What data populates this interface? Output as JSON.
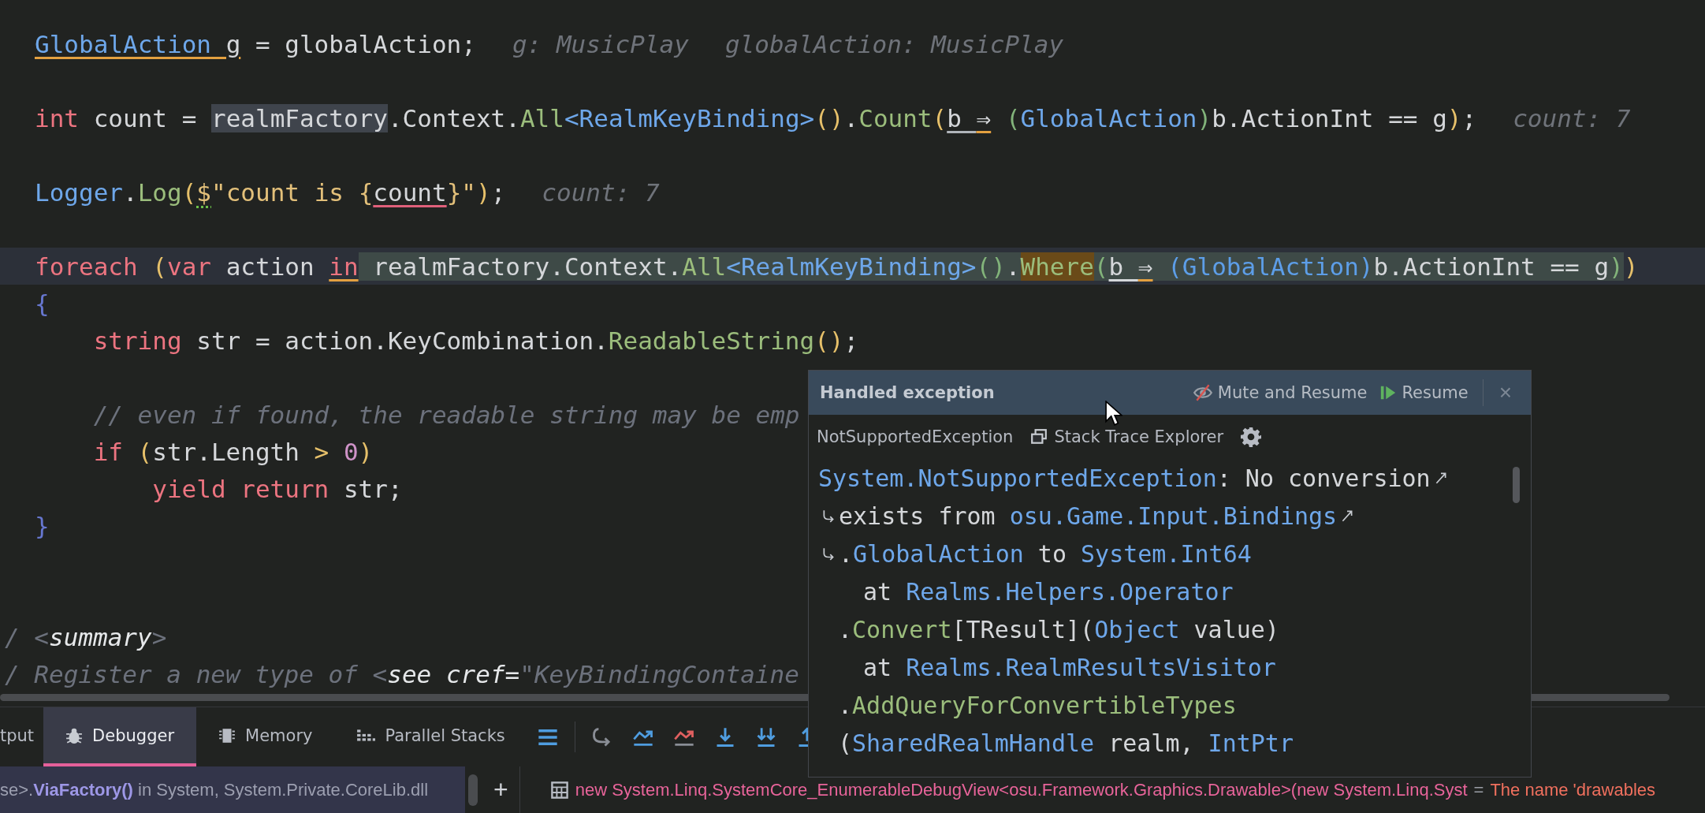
{
  "editor": {
    "lines": [
      {
        "kind": "code",
        "current": false,
        "segments": [
          {
            "text": "GlobalAction",
            "kind": "type",
            "underline": {
              "color": "#e3a040"
            }
          },
          {
            "text": " g",
            "kind": "plain",
            "underline": {
              "color": "#e3a040"
            }
          },
          {
            "text": " = globalAction;",
            "kind": "plain"
          }
        ],
        "hints": [
          "g: MusicPlay",
          "globalAction: MusicPlay"
        ]
      },
      {
        "kind": "blank"
      },
      {
        "kind": "code",
        "current": false,
        "segments": [
          {
            "text": "int",
            "kind": "keyword"
          },
          {
            "text": " count = ",
            "kind": "plain"
          },
          {
            "text": "realmFactory",
            "kind": "plain",
            "usage_highlight": true
          },
          {
            "text": ".Context.",
            "kind": "plain"
          },
          {
            "text": "All",
            "kind": "method"
          },
          {
            "text": "<RealmKeyBinding>",
            "kind": "type"
          },
          {
            "text": "()",
            "kind": "paren1"
          },
          {
            "text": ".",
            "kind": "plain"
          },
          {
            "text": "Count",
            "kind": "method"
          },
          {
            "text": "(",
            "kind": "paren1"
          },
          {
            "text": "b ",
            "kind": "plain",
            "underline": {
              "color": "#b0b4ba"
            }
          },
          {
            "text": "⇒",
            "kind": "plain",
            "underline": {
              "color": "#e3a040"
            }
          },
          {
            "text": " (",
            "kind": "paren2"
          },
          {
            "text": "GlobalAction",
            "kind": "type"
          },
          {
            "text": ")",
            "kind": "paren2"
          },
          {
            "text": "b.ActionInt == g",
            "kind": "plain"
          },
          {
            "text": ")",
            "kind": "paren1"
          },
          {
            "text": ";",
            "kind": "plain"
          }
        ],
        "hints": [
          "count: 7"
        ]
      },
      {
        "kind": "blank"
      },
      {
        "kind": "code",
        "current": false,
        "segments": [
          {
            "text": "Logger",
            "kind": "type"
          },
          {
            "text": ".",
            "kind": "plain"
          },
          {
            "text": "Log",
            "kind": "method"
          },
          {
            "text": "(",
            "kind": "paren1"
          },
          {
            "text": "$",
            "kind": "string",
            "underline": {
              "color": "#6cc04a",
              "dotted": true
            }
          },
          {
            "text": "\"count is {",
            "kind": "string"
          },
          {
            "text": "count",
            "kind": "plain",
            "underline": {
              "color": "#e0607a"
            }
          },
          {
            "text": "}\"",
            "kind": "string"
          },
          {
            "text": ")",
            "kind": "paren1"
          },
          {
            "text": ";",
            "kind": "plain"
          }
        ],
        "hints": [
          "count: 7"
        ]
      },
      {
        "kind": "blank"
      },
      {
        "kind": "code",
        "current": true,
        "segments": [
          {
            "text": "foreach",
            "kind": "keyword"
          },
          {
            "text": " (",
            "kind": "paren1"
          },
          {
            "text": "var",
            "kind": "keyword"
          },
          {
            "text": " action ",
            "kind": "plain"
          },
          {
            "text": "in",
            "kind": "keyword",
            "underline": {
              "color": "#e3a040"
            }
          },
          {
            "text": " realmFactory.Context.",
            "kind": "plain",
            "selection": true
          },
          {
            "text": "All",
            "kind": "method",
            "selection": true
          },
          {
            "text": "<RealmKeyBinding>",
            "kind": "type",
            "selection": true
          },
          {
            "text": "()",
            "kind": "paren2",
            "selection": true
          },
          {
            "text": ".",
            "kind": "plain",
            "selection": true
          },
          {
            "text": "Where",
            "kind": "method",
            "selection": true,
            "search_match": true
          },
          {
            "text": "(",
            "kind": "paren2",
            "selection": true
          },
          {
            "text": "b ",
            "kind": "plain",
            "selection": true,
            "underline": {
              "color": "#d5d7da"
            }
          },
          {
            "text": "⇒",
            "kind": "plain",
            "selection": true,
            "underline": {
              "color": "#e3a040"
            }
          },
          {
            "text": " (GlobalAction)",
            "kind": "paren3",
            "selection": true
          },
          {
            "text": "b.ActionInt == g",
            "kind": "plain",
            "selection": true
          },
          {
            "text": ")",
            "kind": "paren2",
            "selection": true
          },
          {
            "text": ")",
            "kind": "paren1"
          }
        ]
      },
      {
        "kind": "code",
        "current": false,
        "segments": [
          {
            "text": "{",
            "kind": "brace"
          }
        ],
        "children": [
          {
            "kind": "code",
            "current": false,
            "segments": [
              {
                "text": "string",
                "kind": "keyword"
              },
              {
                "text": " str = action.KeyCombination.",
                "kind": "plain"
              },
              {
                "text": "ReadableString",
                "kind": "method"
              },
              {
                "text": "()",
                "kind": "paren1"
              },
              {
                "text": ";",
                "kind": "plain"
              }
            ]
          },
          {
            "kind": "blank"
          },
          {
            "kind": "code",
            "current": false,
            "segments": [
              {
                "text": "// even if found, the readable string may be emp",
                "kind": "comment"
              }
            ]
          },
          {
            "kind": "code",
            "current": false,
            "segments": [
              {
                "text": "if",
                "kind": "keyword"
              },
              {
                "text": " (",
                "kind": "paren1"
              },
              {
                "text": "str.Length ",
                "kind": "plain"
              },
              {
                "text": "> ",
                "kind": "operator"
              },
              {
                "text": "0",
                "kind": "number"
              },
              {
                "text": ")",
                "kind": "paren1"
              }
            ],
            "children": [
              {
                "kind": "code",
                "current": false,
                "segments": [
                  {
                    "text": "yield return",
                    "kind": "keyword"
                  },
                  {
                    "text": " str;",
                    "kind": "plain"
                  }
                ]
              }
            ]
          }
        ]
      },
      {
        "kind": "code",
        "current": false,
        "segments": [
          {
            "text": "}",
            "kind": "brace"
          }
        ]
      },
      {
        "kind": "blank"
      },
      {
        "kind": "blank"
      },
      {
        "kind": "doc",
        "current": false,
        "segments": [
          {
            "text": "/ <",
            "kind": "comment"
          },
          {
            "text": "summary",
            "kind": "doc-tag"
          },
          {
            "text": ">",
            "kind": "comment"
          }
        ]
      },
      {
        "kind": "doc",
        "current": false,
        "segments": [
          {
            "text": "/ Register a new type of <",
            "kind": "comment"
          },
          {
            "text": "see cref=",
            "kind": "doc-tag"
          },
          {
            "text": "\"KeyBindingContaine",
            "kind": "comment"
          }
        ]
      }
    ]
  },
  "exception_popup": {
    "title": "Handled exception",
    "actions": [
      "Mute and Resume",
      "Resume"
    ],
    "close": "×",
    "exception_type": "NotSupportedException",
    "explorer_link": "Stack Trace Explorer",
    "trace_lines": [
      {
        "kind": "message",
        "wrap_start": false,
        "wrap_end": true,
        "segments": [
          {
            "text": "System.NotSupportedException",
            "kind": "type"
          },
          {
            "text": ": No conversion",
            "kind": "plain"
          }
        ]
      },
      {
        "kind": "message",
        "wrap_start": true,
        "wrap_end": true,
        "segments": [
          {
            "text": "exists from ",
            "kind": "plain"
          },
          {
            "text": "osu.Game.Input.Bindings",
            "kind": "type"
          }
        ]
      },
      {
        "kind": "message",
        "wrap_start": true,
        "wrap_end": false,
        "segments": [
          {
            "text": ".",
            "kind": "plain"
          },
          {
            "text": "GlobalAction",
            "kind": "type"
          },
          {
            "text": " to ",
            "kind": "plain"
          },
          {
            "text": "System.Int64",
            "kind": "type"
          }
        ]
      },
      {
        "kind": "frame",
        "wrap_start": false,
        "wrap_end": false,
        "segments": [
          {
            "text": "at ",
            "kind": "plain"
          },
          {
            "text": "Realms.Helpers.Operator",
            "kind": "type"
          }
        ]
      },
      {
        "kind": "continuation",
        "wrap_start": false,
        "wrap_end": false,
        "segments": [
          {
            "text": ".",
            "kind": "plain"
          },
          {
            "text": "Convert",
            "kind": "method"
          },
          {
            "text": "[TResult](",
            "kind": "plain"
          },
          {
            "text": "Object",
            "kind": "type"
          },
          {
            "text": " value)",
            "kind": "plain"
          }
        ]
      },
      {
        "kind": "frame",
        "wrap_start": false,
        "wrap_end": false,
        "segments": [
          {
            "text": "at ",
            "kind": "plain"
          },
          {
            "text": "Realms.RealmResultsVisitor",
            "kind": "type"
          }
        ]
      },
      {
        "kind": "continuation",
        "wrap_start": false,
        "wrap_end": false,
        "segments": [
          {
            "text": ".",
            "kind": "plain"
          },
          {
            "text": "AddQueryForConvertibleTypes",
            "kind": "method"
          }
        ]
      },
      {
        "kind": "continuation",
        "wrap_start": false,
        "wrap_end": false,
        "segments": [
          {
            "text": "(",
            "kind": "plain"
          },
          {
            "text": "SharedRealmHandle",
            "kind": "type"
          },
          {
            "text": " realm, ",
            "kind": "plain"
          },
          {
            "text": "IntPtr",
            "kind": "type"
          }
        ]
      }
    ]
  },
  "tool_tabs": [
    {
      "label": "tput",
      "selected": false
    },
    {
      "label": "Debugger",
      "selected": true
    },
    {
      "label": "Memory",
      "selected": false
    },
    {
      "label": "Parallel Stacks",
      "selected": false
    }
  ],
  "frames": {
    "text": "se>.**ViaFactory()** in System, System.Private.CoreLib.dll",
    "add": "+"
  },
  "watch": {
    "expression": "new System.Linq.SystemCore_EnumerableDebugView<osu.Framework.Graphics.Drawable>(new System.Linq.Syst",
    "separator": "=",
    "value": "The name 'drawables"
  }
}
